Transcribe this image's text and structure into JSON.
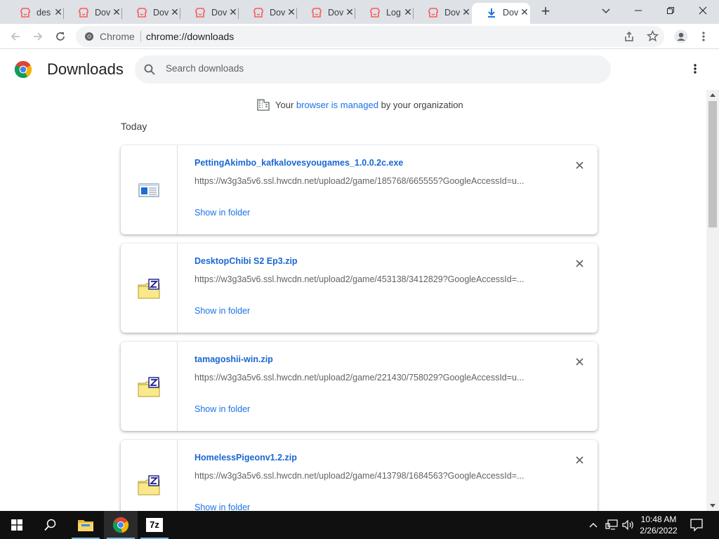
{
  "browser": {
    "tabs": [
      {
        "title": "des",
        "icon": "itch-icon",
        "active": false
      },
      {
        "title": "Dov",
        "icon": "itch-icon",
        "active": false
      },
      {
        "title": "Dov",
        "icon": "itch-icon",
        "active": false
      },
      {
        "title": "Dov",
        "icon": "itch-icon",
        "active": false
      },
      {
        "title": "Dov",
        "icon": "itch-icon",
        "active": false
      },
      {
        "title": "Dov",
        "icon": "itch-icon",
        "active": false
      },
      {
        "title": "Log",
        "icon": "itch-icon",
        "active": false
      },
      {
        "title": "Dov",
        "icon": "itch-icon",
        "active": false
      },
      {
        "title": "Dov",
        "icon": "download-icon",
        "active": true
      }
    ],
    "omnibox": {
      "chip": "Chrome",
      "url": "chrome://downloads"
    }
  },
  "downloads": {
    "title": "Downloads",
    "search_placeholder": "Search downloads",
    "managed": {
      "prefix": "Your",
      "link": "browser is managed",
      "suffix": "by your organization"
    },
    "section": "Today",
    "items": [
      {
        "file": "PettingAkimbo_kafkalovesyougames_1.0.0.2c.exe",
        "url": "https://w3g3a5v6.ssl.hwcdn.net/upload2/game/185768/665555?GoogleAccessId=u...",
        "action": "Show in folder",
        "icon": "exe-file-icon"
      },
      {
        "file": "DesktopChibi S2 Ep3.zip",
        "url": "https://w3g3a5v6.ssl.hwcdn.net/upload2/game/453138/3412829?GoogleAccessId=...",
        "action": "Show in folder",
        "icon": "zip-file-icon"
      },
      {
        "file": "tamagoshii-win.zip",
        "url": "https://w3g3a5v6.ssl.hwcdn.net/upload2/game/221430/758029?GoogleAccessId=u...",
        "action": "Show in folder",
        "icon": "zip-file-icon"
      },
      {
        "file": "HomelessPigeonv1.2.zip",
        "url": "https://w3g3a5v6.ssl.hwcdn.net/upload2/game/413798/1684563?GoogleAccessId=...",
        "action": "Show in folder",
        "icon": "zip-file-icon"
      }
    ]
  },
  "taskbar": {
    "clock_time": "10:48 AM",
    "clock_date": "2/26/2022",
    "apps": [
      "file-explorer-icon",
      "chrome-icon",
      "7zip-icon"
    ]
  },
  "colors": {
    "link": "#1a73e8",
    "filename": "#1967d2",
    "tabstrip": "#dee1e6",
    "taskbar": "#101010"
  }
}
